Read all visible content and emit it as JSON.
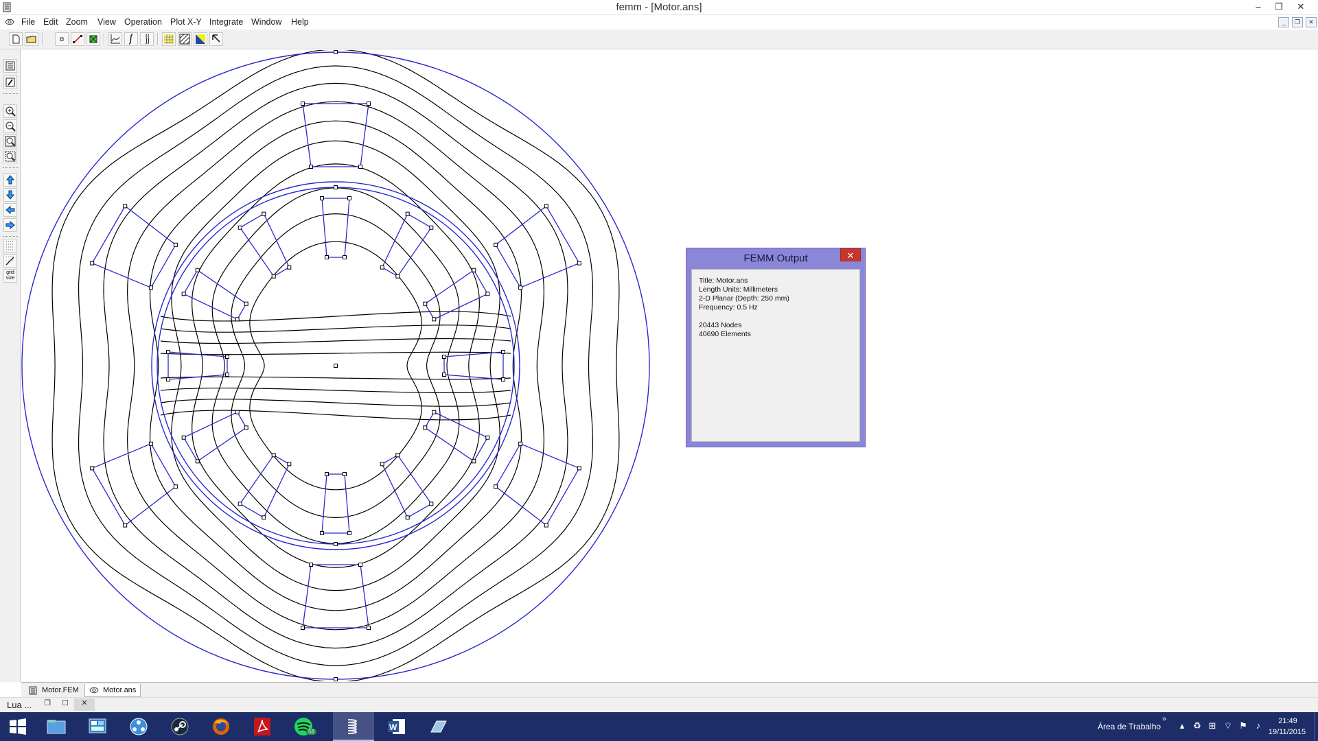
{
  "window": {
    "title": "femm - [Motor.ans]"
  },
  "menu": {
    "items": [
      "File",
      "Edit",
      "Zoom",
      "View",
      "Operation",
      "Plot X-Y",
      "Integrate",
      "Window",
      "Help"
    ]
  },
  "toolbar": {
    "buttons": [
      "new-file",
      "open-file",
      "point-mode",
      "contour-mode",
      "area-mode",
      "plot-xy",
      "integrate-line",
      "integrate-block",
      "density-plot",
      "vector-plot",
      "color-map",
      "pointer"
    ]
  },
  "left_toolbar": {
    "grid_size_label": "grid size"
  },
  "doc_tabs": [
    {
      "label": "Motor.FEM",
      "active": false
    },
    {
      "label": "Motor.ans",
      "active": true
    }
  ],
  "lua_console": {
    "label": "Lua ..."
  },
  "output_window": {
    "title": "FEMM Output",
    "lines": [
      "Title: Motor.ans",
      "Length Units: Millimeters",
      "2-D Planar (Depth: 250 mm)",
      "Frequency: 0.5 Hz",
      "",
      "20443 Nodes",
      "40690 Elements"
    ]
  },
  "taskbar": {
    "tray_label": "Área de Trabalho",
    "chevron": "»",
    "spotify_badge": "58",
    "time": "21:49",
    "date": "19/11/2015",
    "apps": [
      "windows-explorer",
      "control-panel",
      "network-sharing",
      "steam",
      "firefox",
      "acrobat",
      "spotify",
      "femm",
      "word",
      "eraser"
    ]
  },
  "colors": {
    "geometry_blue": "#2828d0",
    "contour_black": "#000000",
    "output_frame": "#8a86d8",
    "close_red": "#c8362b",
    "taskbar": "#1d2d68"
  }
}
